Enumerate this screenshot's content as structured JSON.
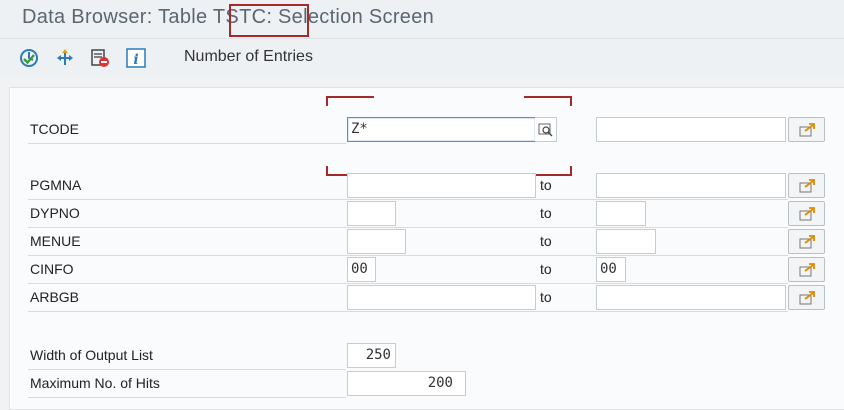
{
  "window": {
    "title": "Data Browser: Table TSTC: Selection Screen"
  },
  "toolbar": {
    "buttons": [
      {
        "icon": "execute-icon"
      },
      {
        "icon": "selection-options-icon"
      },
      {
        "icon": "delete-selection-icon"
      },
      {
        "icon": "info-icon"
      }
    ],
    "number_of_entries_label": "Number of Entries"
  },
  "selection": {
    "to_label": "to",
    "rows": [
      {
        "label": "TCODE",
        "low": "Z*",
        "high": ""
      },
      {
        "label": "PGMNA",
        "low": "",
        "high": ""
      },
      {
        "label": "DYPNO",
        "low": "",
        "high": ""
      },
      {
        "label": "MENUE",
        "low": "",
        "high": ""
      },
      {
        "label": "CINFO",
        "low": "00",
        "high": "00"
      },
      {
        "label": "ARBGB",
        "low": "",
        "high": ""
      }
    ]
  },
  "settings": {
    "width_label": "Width of Output List",
    "width_value": "250",
    "max_hits_label": "Maximum No. of Hits",
    "max_hits_value": "200"
  },
  "colors": {
    "highlight": "#a52a2a",
    "background": "#f0f2f4",
    "focus_border": "#5a8fc5"
  }
}
